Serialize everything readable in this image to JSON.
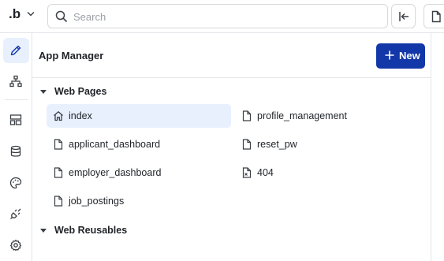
{
  "topbar": {
    "logo": ".b",
    "search_placeholder": "Search"
  },
  "rail": {
    "items": [
      {
        "icon": "pencil-icon",
        "active": true
      },
      {
        "icon": "sitemap-icon",
        "active": false
      },
      {
        "icon": "layout-icon",
        "active": false
      },
      {
        "icon": "database-icon",
        "active": false
      },
      {
        "icon": "palette-icon",
        "active": false
      },
      {
        "icon": "plug-icon",
        "active": false
      },
      {
        "icon": "gear-icon",
        "active": false
      }
    ]
  },
  "panel": {
    "title": "App Manager",
    "new_button": "New",
    "sections": [
      {
        "title": "Web Pages",
        "pages": [
          {
            "label": "index",
            "icon": "home-icon",
            "selected": true
          },
          {
            "label": "profile_management",
            "icon": "file-icon"
          },
          {
            "label": "applicant_dashboard",
            "icon": "file-icon"
          },
          {
            "label": "reset_pw",
            "icon": "file-icon"
          },
          {
            "label": "employer_dashboard",
            "icon": "file-icon"
          },
          {
            "label": "404",
            "icon": "file-error-icon"
          },
          {
            "label": "job_postings",
            "icon": "file-icon"
          }
        ]
      },
      {
        "title": "Web Reusables",
        "pages": []
      }
    ]
  },
  "colors": {
    "accent": "#1237a8",
    "selected_bg": "#e8f0fd",
    "border": "#e3e5e8"
  }
}
